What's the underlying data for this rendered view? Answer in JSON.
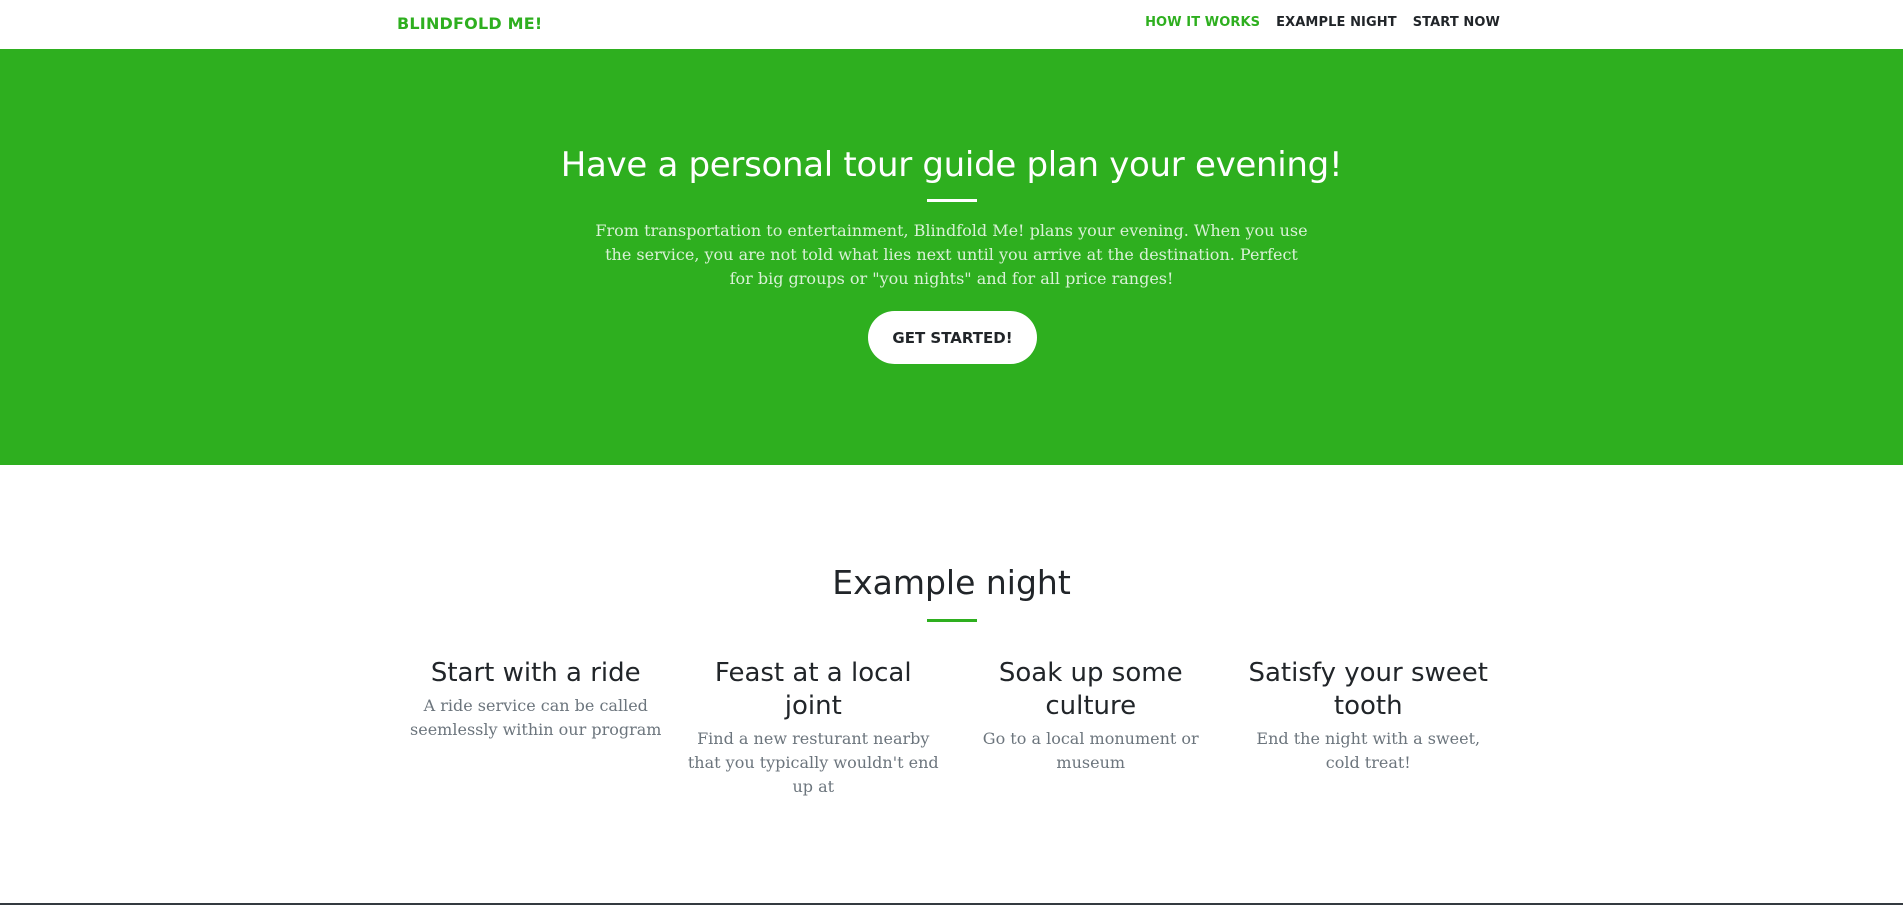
{
  "nav": {
    "brand": "BLINDFOLD ME!",
    "links": [
      {
        "label": "HOW IT WORKS",
        "active": true
      },
      {
        "label": "EXAMPLE NIGHT",
        "active": false
      },
      {
        "label": "START NOW",
        "active": false
      }
    ]
  },
  "hero": {
    "title": "Have a personal tour guide plan your evening!",
    "text": "From transportation to entertainment, Blindfold Me! plans your evening. When you use the service, you are not told what lies next until you arrive at the destination. Perfect for big groups or \"you nights\" and for all price ranges!",
    "button": "GET STARTED!"
  },
  "example": {
    "title": "Example night",
    "features": [
      {
        "title": "Start with a ride",
        "text": "A ride service can be called seemlessly within our program"
      },
      {
        "title": "Feast at a local joint",
        "text": "Find a new resturant nearby that you typically wouldn't end up at"
      },
      {
        "title": "Soak up some culture",
        "text": "Go to a local monument or museum"
      },
      {
        "title": "Satisfy your sweet tooth",
        "text": "End the night with a sweet, cold treat!"
      }
    ]
  },
  "colors": {
    "primary": "#2eaf1f",
    "text": "#212529",
    "muted": "#6c757d"
  }
}
